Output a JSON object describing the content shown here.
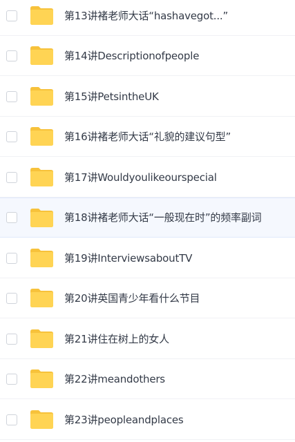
{
  "file_list": {
    "items": [
      {
        "name": "第13讲褚老师大话“hashavegot...”",
        "type": "folder",
        "icon": "folder-icon",
        "selected": false
      },
      {
        "name": "第14讲Descriptionofpeople",
        "type": "folder",
        "icon": "folder-icon",
        "selected": false
      },
      {
        "name": "第15讲PetsintheUK",
        "type": "folder",
        "icon": "folder-icon",
        "selected": false
      },
      {
        "name": "第16讲褚老师大话“礼貌的建议句型”",
        "type": "folder",
        "icon": "folder-icon",
        "selected": false
      },
      {
        "name": "第17讲Wouldyoulikeourspecial",
        "type": "folder",
        "icon": "folder-icon",
        "selected": false
      },
      {
        "name": "第18讲褚老师大话“一般现在时”的频率副词",
        "type": "folder",
        "icon": "folder-icon",
        "selected": false,
        "hovered": true
      },
      {
        "name": "第19讲InterviewsaboutTV",
        "type": "folder",
        "icon": "folder-icon",
        "selected": false
      },
      {
        "name": "第20讲英国青少年看什么节目",
        "type": "folder",
        "icon": "folder-icon",
        "selected": false
      },
      {
        "name": "第21讲住在树上的女人",
        "type": "folder",
        "icon": "folder-icon",
        "selected": false
      },
      {
        "name": "第22讲meandothers",
        "type": "folder",
        "icon": "folder-icon",
        "selected": false
      },
      {
        "name": "第23讲peopleandplaces",
        "type": "folder",
        "icon": "folder-icon",
        "selected": false
      }
    ]
  },
  "colors": {
    "folder_body": "#ffd454",
    "folder_tab": "#f7c23b",
    "text": "#333a47",
    "highlight_bg": "#f5f8fe",
    "divider": "#f0f1f5"
  }
}
